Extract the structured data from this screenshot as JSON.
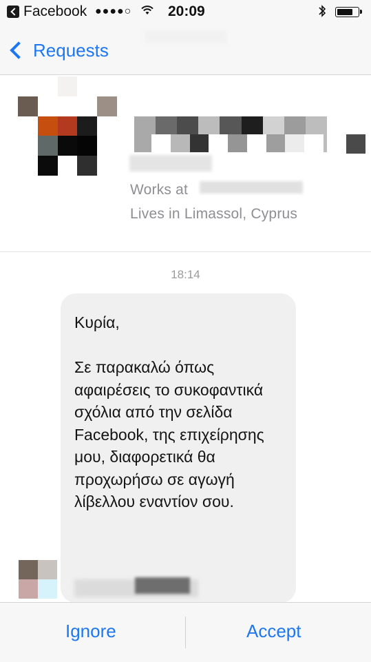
{
  "status_bar": {
    "app": "Facebook",
    "signal": "●●●●○",
    "time": "20:09",
    "bluetooth": "∗",
    "icons": [
      "back-to-app-icon",
      "wifi-icon",
      "bluetooth-icon",
      "battery-icon"
    ]
  },
  "nav": {
    "back_label": "Requests",
    "icons": [
      "chevron-left-icon"
    ]
  },
  "profile": {
    "works_at": "Works at",
    "lives_in": "Lives in Limassol, Cyprus"
  },
  "chat": {
    "timestamp": "18:14",
    "message": "Κυρία,\n\nΣε παρακαλώ όπως αφαιρέσεις το συκοφαντικά σχόλια από την σελίδα Facebook, της επιχείρησης μου, διαφορετικά θα προχωρήσω σε αγωγή λίβελλου εναντίον σου."
  },
  "actions": {
    "ignore": "Ignore",
    "accept": "Accept"
  },
  "colors": {
    "accent": "#1d77f2",
    "bubble": "#f1f0f0",
    "secondary_text": "#8e8e93"
  }
}
